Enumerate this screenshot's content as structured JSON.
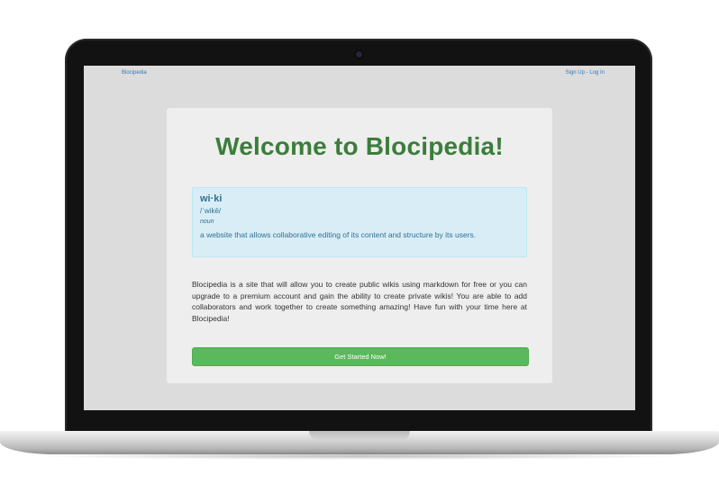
{
  "navbar": {
    "brand": "Blocipedia",
    "sign_up": "Sign Up",
    "separator": "-",
    "log_in": "Log In"
  },
  "hero": {
    "title": "Welcome to Blocipedia!",
    "definition": {
      "word": "wi·ki",
      "pronunciation": "/ˈwikē/",
      "part_of_speech": "noun",
      "meaning": "a website that allows collaborative editing of its content and structure by its users."
    },
    "intro": "Blocipedia is a site that will allow you to create public wikis using markdown for free or you can upgrade to a premium account and gain the ability to create private wikis! You are able to add collaborators and work together to create something amazing! Have fun with your time here at Blocipedia!",
    "cta_label": "Get Started Now!"
  },
  "colors": {
    "title": "#3b7d3b",
    "cta": "#5cb85c",
    "info_bg": "#d9edf7",
    "info_text": "#31708f",
    "link": "#337ab7"
  }
}
